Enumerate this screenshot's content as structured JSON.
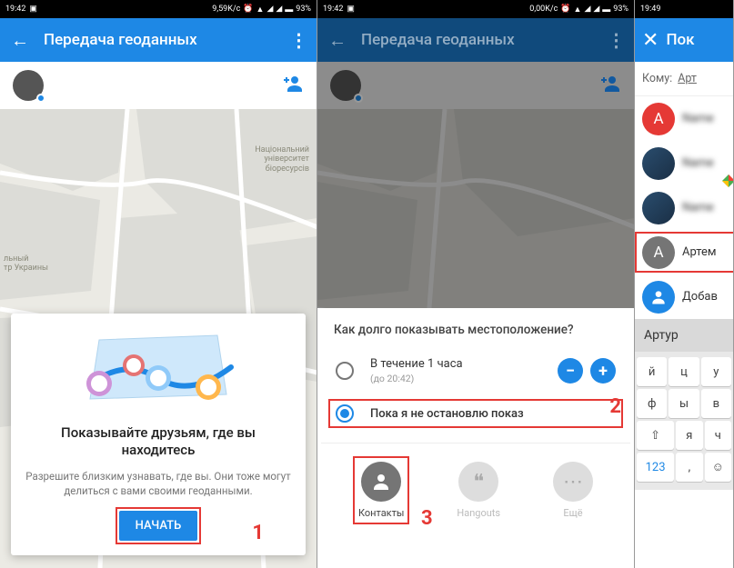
{
  "screen1": {
    "status": {
      "time": "19:42",
      "speed": "9,59K/c",
      "battery": "93%"
    },
    "appbar": {
      "title": "Передача геоданных"
    },
    "card": {
      "heading": "Показывайте друзьям, где вы находитесь",
      "body": "Разрешите близким узнавать, где вы. Они тоже могут делиться с вами своими геоданными.",
      "button": "НАЧАТЬ"
    },
    "annotation": "1",
    "map_labels": {
      "uni1": "Національний",
      "uni2": "університет",
      "uni3": "біоресурсів",
      "bottom1": "льный",
      "bottom2": "тр Украины"
    }
  },
  "screen2": {
    "status": {
      "time": "19:42",
      "speed": "0,00K/c",
      "battery": "93%"
    },
    "appbar": {
      "title": "Передача геоданных"
    },
    "sheet": {
      "question": "Как долго показывать местоположение?",
      "opt1_main": "В течение 1 часа",
      "opt1_sub": "(до 20:42)",
      "opt2": "Пока я не остановлю показ",
      "targets": {
        "contacts": "Контакты",
        "hangouts": "Hangouts",
        "more": "Ещё"
      }
    },
    "annotation_opt": "2",
    "annotation_tgt": "3"
  },
  "screen3": {
    "status": {
      "time": "19:49"
    },
    "appbar": {
      "title": "Пок"
    },
    "komu_label": "Кому:",
    "komu_chip": "Арт",
    "contacts": {
      "c3_name": "Артем",
      "c4_name": "Добав"
    },
    "suggest": "Артур",
    "key123": "123",
    "keys_r1": [
      "й",
      "ц",
      "у"
    ],
    "keys_r2": [
      "ф",
      "ы",
      "в"
    ],
    "keys_r3": [
      "я",
      "ч"
    ]
  }
}
